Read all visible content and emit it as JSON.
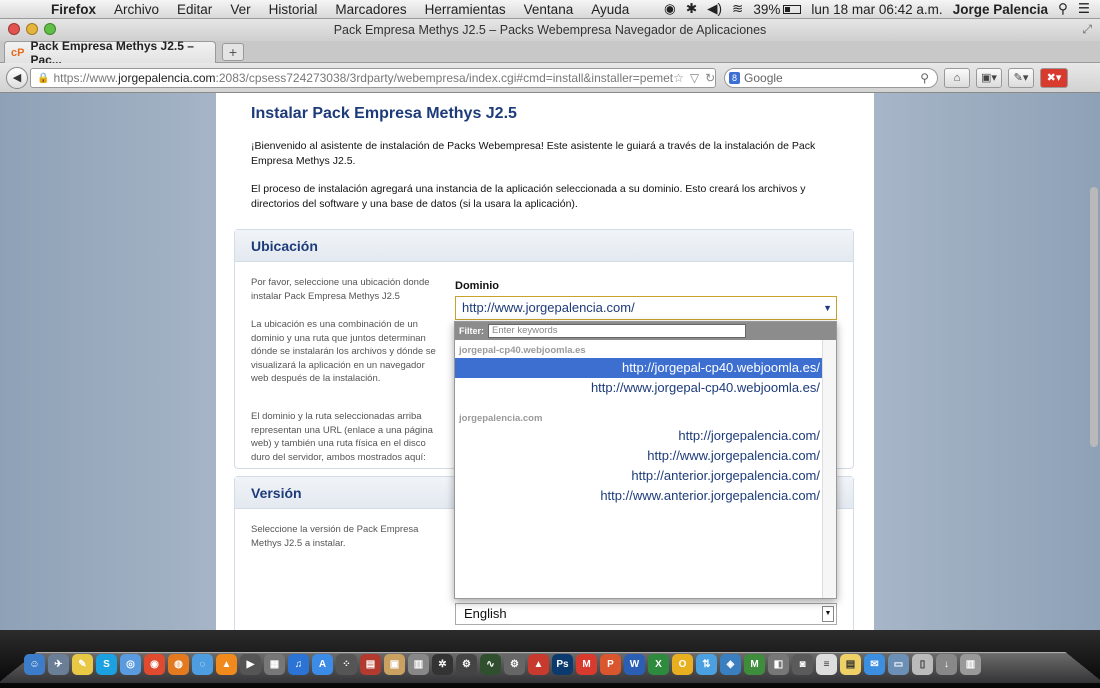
{
  "menubar": {
    "apple": "",
    "items": [
      "Firefox",
      "Archivo",
      "Editar",
      "Ver",
      "Historial",
      "Marcadores",
      "Herramientas",
      "Ventana",
      "Ayuda"
    ],
    "battery": "39%",
    "datetime": "lun 18 mar  06:42 a.m.",
    "user": "Jorge Palencia"
  },
  "window": {
    "title": "Pack Empresa Methys J2.5 – Packs Webempresa Navegador de Aplicaciones"
  },
  "tabs": {
    "active_favicon": "cP",
    "active_label": "Pack Empresa Methys J2.5 – Pac...",
    "new_tab": "+"
  },
  "navbar": {
    "url_prefix": "https://www.",
    "url_domain": "jorgepalencia.com",
    "url_rest": ":2083/cpsess724273038/3rdparty/webempresa/index.cgi#cmd=install&installer=pemet",
    "search_engine": "8",
    "search_placeholder": "Google"
  },
  "page": {
    "title": "Instalar Pack Empresa Methys J2.5",
    "intro1": "¡Bienvenido al asistente de instalación de Packs Webempresa! Este asistente le guiará a través de la instalación de Pack Empresa Methys J2.5.",
    "intro2": "El proceso de instalación agregará una instancia de la aplicación seleccionada a su dominio. Esto creará los archivos y directorios del software y una base de datos (si la usara la aplicación).",
    "ubicacion": {
      "heading": "Ubicación",
      "help1": "Por favor, seleccione una ubicación donde instalar Pack Empresa Methys J2.5",
      "help2": "La ubicación es una combinación de un dominio y una ruta que juntos determinan dónde se instalarán los archivos y dónde se visualizará la aplicación en un navegador web después de la instalación.",
      "help3": "El dominio y la ruta seleccionadas arriba representan una URL (enlace a una página web) y también una ruta física en el disco duro del servidor, ambos mostrados aquí:",
      "domain_label": "Dominio",
      "domain_value": "http://www.jorgepalencia.com/"
    },
    "version": {
      "heading": "Versión",
      "help": "Seleccione la versión de Pack Empresa Methys J2.5 a instalar.",
      "language_value": "English"
    }
  },
  "dropdown": {
    "filter_label": "Filter:",
    "filter_placeholder": "Enter keywords",
    "groups": [
      {
        "name": "jorgepal-cp40.webjoomla.es",
        "options": [
          "http://jorgepal-cp40.webjoomla.es/",
          "http://www.jorgepal-cp40.webjoomla.es/"
        ]
      },
      {
        "name": "jorgepalencia.com",
        "options": [
          "http://jorgepalencia.com/",
          "http://www.jorgepalencia.com/",
          "http://anterior.jorgepalencia.com/",
          "http://www.anterior.jorgepalencia.com/"
        ]
      }
    ],
    "selected": "http://jorgepal-cp40.webjoomla.es/"
  },
  "colors": {
    "heading_blue": "#1d3b7a",
    "selection_blue": "#3d6fd1"
  }
}
